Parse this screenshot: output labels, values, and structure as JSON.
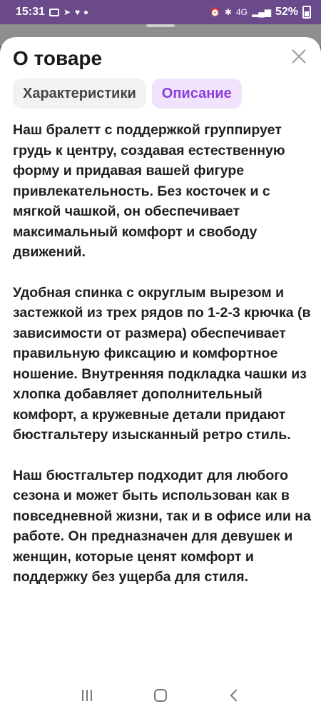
{
  "status_bar": {
    "time": "15:31",
    "network": "4G",
    "battery": "52%"
  },
  "sheet": {
    "title": "О товаре",
    "close_icon": "close-icon"
  },
  "tabs": [
    {
      "label": "Характеристики",
      "active": false
    },
    {
      "label": "Описание",
      "active": true
    }
  ],
  "description": {
    "paragraphs": [
      "Наш бралетт с поддержкой группирует грудь к центру, создавая естественную форму и придавая вашей фигуре привлекательность. Без косточек и с мягкой чашкой, он обеспечивает максимальный комфорт и свободу движений.",
      "Удобная спинка с округлым вырезом и застежкой из трех рядов по 1-2-3 крючка (в зависимости от размера) обеспечивает правильную фиксацию и комфортное ношение. Внутренняя подкладка чашки из хлопка добавляет дополнительный комфорт, а кружевные детали придают бюстгальтеру изысканный ретро стиль.",
      "Наш бюстгальтер подходит для любого сезона и может быть использован как в повседневной жизни, так и в офисе или на работе. Он предназначен для девушек и женщин, которые ценят комфорт и поддержку без ущерба для стиля."
    ]
  },
  "colors": {
    "accent": "#8b3fd9",
    "active_tab_bg": "#f0e3fb",
    "inactive_tab_bg": "#f2f2f5",
    "status_bar_bg": "#6a4a8a"
  }
}
